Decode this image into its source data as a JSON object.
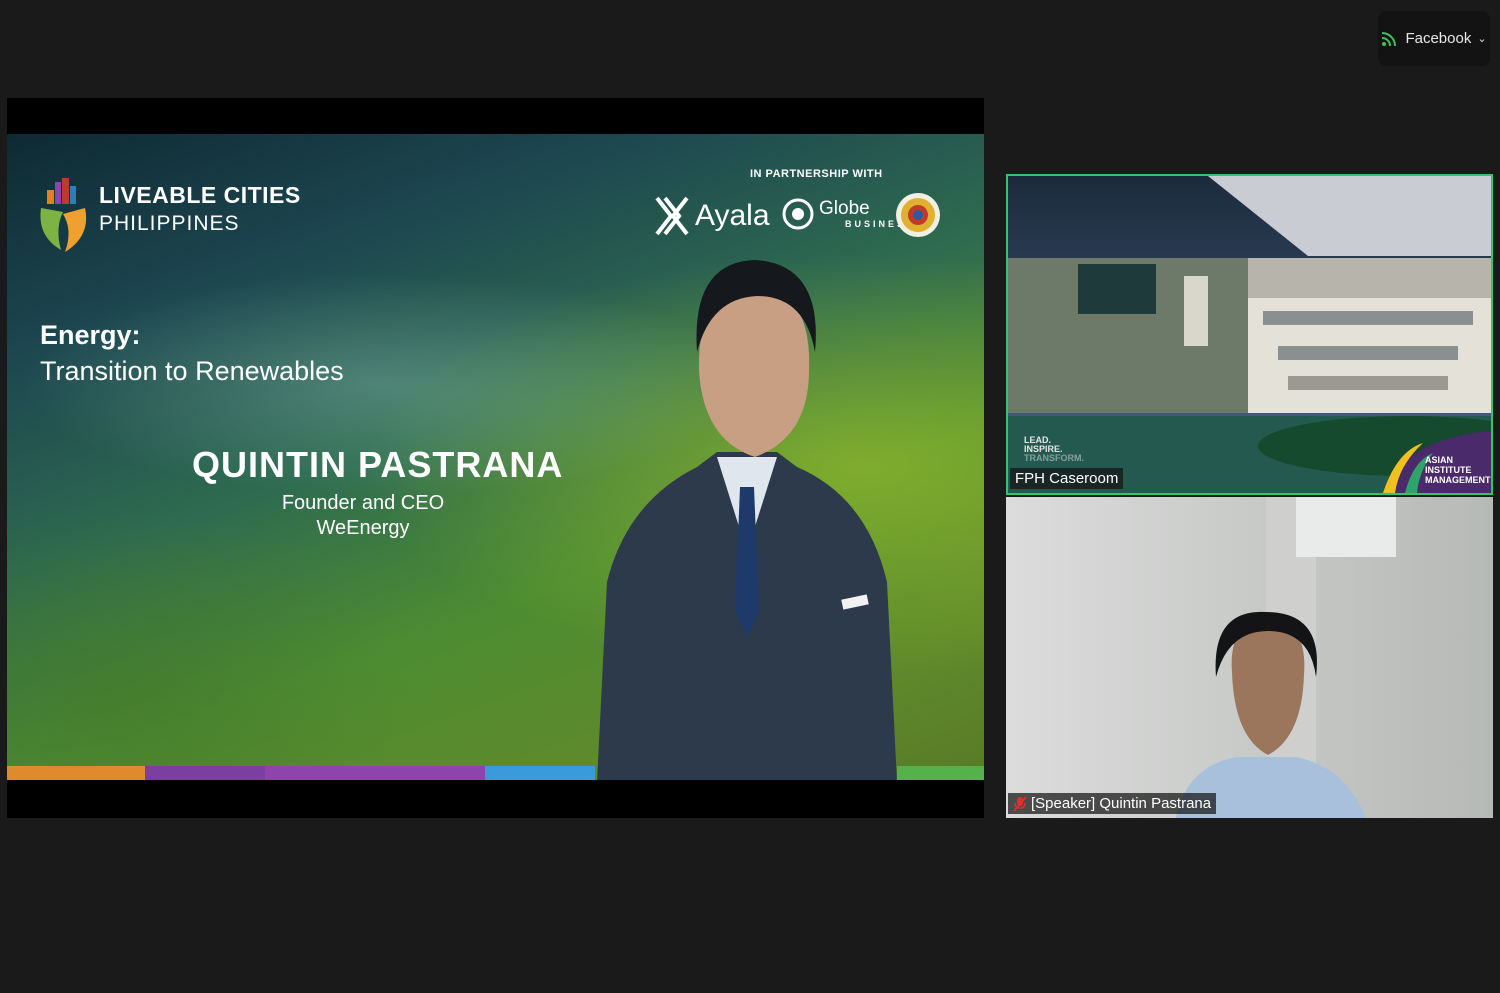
{
  "live": {
    "label": "Facebook",
    "icon": "live-stream-icon"
  },
  "slide": {
    "logo_title": "LIVEABLE CITIES",
    "logo_subtitle": "PHILIPPINES",
    "partnership_label": "IN PARTNERSHIP WITH",
    "partner_ayala": "Ayala",
    "partner_globe": "Globe",
    "partner_globe_sub": "BUSINESS",
    "topic": "Energy:",
    "subtopic": "Transition to Renewables",
    "speaker_name": "QUINTIN PASTRANA",
    "speaker_role": "Founder and CEO",
    "speaker_org": "WeEnergy",
    "stripe_colors": [
      "#e08a2e",
      "#7a3fa0",
      "#8e44ad",
      "#3b9ad9",
      "#55b24a"
    ]
  },
  "tiles": [
    {
      "name": "FPH Caseroom",
      "active_speaker": true,
      "overlay_lines": [
        "LEAD.",
        "INSPIRE.",
        "TRANSFORM."
      ],
      "badge": [
        "ASIAN",
        "INSTITUTE",
        "MANAGEMENT"
      ]
    },
    {
      "name": "[Speaker] Quintin Pastrana",
      "muted": true
    }
  ],
  "colors": {
    "active_border": "#35c46b",
    "live_icon": "#3cc45c",
    "muted_icon": "#e0302a"
  }
}
